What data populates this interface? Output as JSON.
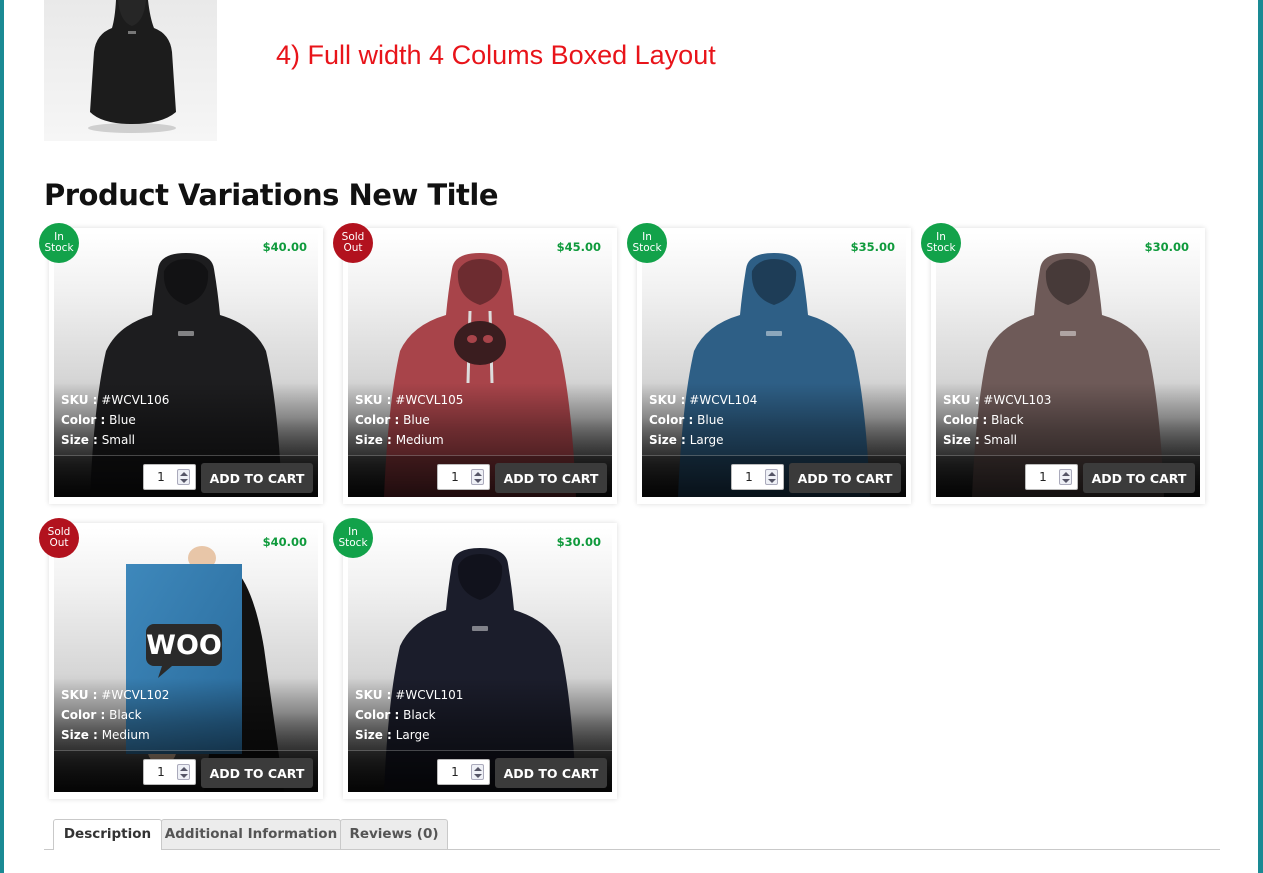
{
  "heading": "4) Full width 4 Colums Boxed Layout",
  "section_title": "Product Variations New Title",
  "labels": {
    "sku": "SKU :",
    "color": "Color :",
    "size": "Size :"
  },
  "colors": {
    "in_stock": "#12a24a",
    "sold_out": "#b2121e",
    "price": "#0f9a3c",
    "heading": "#e8141a"
  },
  "main_image": {
    "icon": "hoodie-black-back"
  },
  "products": [
    {
      "badge_line1": "In",
      "badge_line2": "Stock",
      "price": "$40.00",
      "sku": "#WCVL106",
      "color": "Blue",
      "size": "Small",
      "qty": "1",
      "cart_label": "ADD TO CART",
      "icon": "hoodie-black"
    },
    {
      "badge_line1": "Sold",
      "badge_line2": "Out",
      "price": "$45.00",
      "sku": "#WCVL105",
      "color": "Blue",
      "size": "Medium",
      "qty": "1",
      "cart_label": "ADD TO CART",
      "icon": "hoodie-red-ninja"
    },
    {
      "badge_line1": "In",
      "badge_line2": "Stock",
      "price": "$35.00",
      "sku": "#WCVL104",
      "color": "Blue",
      "size": "Large",
      "qty": "1",
      "cart_label": "ADD TO CART",
      "icon": "hoodie-blue"
    },
    {
      "badge_line1": "In",
      "badge_line2": "Stock",
      "price": "$30.00",
      "sku": "#WCVL103",
      "color": "Black",
      "size": "Small",
      "qty": "1",
      "cart_label": "ADD TO CART",
      "icon": "hoodie-brown"
    },
    {
      "badge_line1": "Sold",
      "badge_line2": "Out",
      "price": "$40.00",
      "sku": "#WCVL102",
      "color": "Black",
      "size": "Medium",
      "qty": "1",
      "cart_label": "ADD TO CART",
      "icon": "woo-poster"
    },
    {
      "badge_line1": "In",
      "badge_line2": "Stock",
      "price": "$30.00",
      "sku": "#WCVL101",
      "color": "Black",
      "size": "Large",
      "qty": "1",
      "cart_label": "ADD TO CART",
      "icon": "hoodie-navy"
    }
  ],
  "poster_text": "WOO",
  "tabs": [
    {
      "label": "Description",
      "active": true
    },
    {
      "label": "Additional Information",
      "active": false
    },
    {
      "label": "Reviews (0)",
      "active": false
    }
  ]
}
